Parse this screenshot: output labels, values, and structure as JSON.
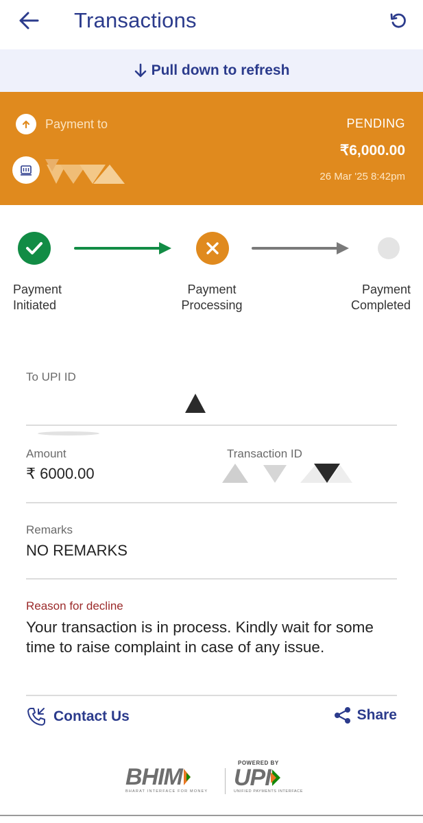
{
  "header": {
    "title": "Transactions"
  },
  "banner": {
    "text": "Pull down to refresh"
  },
  "payment": {
    "direction_label": "Payment to",
    "status": "PENDING",
    "amount": "₹6,000.00",
    "datetime": "26 Mar '25 8:42pm"
  },
  "steps": [
    {
      "label": "Payment Initiated",
      "state": "done"
    },
    {
      "label": "Payment Processing",
      "state": "failed"
    },
    {
      "label": "Payment Completed",
      "state": "pending"
    }
  ],
  "details": {
    "upi_label": "To UPI ID",
    "amount_label": "Amount",
    "amount_value": "₹ 6000.00",
    "txn_label": "Transaction ID",
    "remarks_label": "Remarks",
    "remarks_value": "NO REMARKS",
    "reason_label": "Reason for decline",
    "reason_value": "Your transaction is in process. Kindly wait for some time to raise complaint in case of any issue."
  },
  "actions": {
    "contact": "Contact Us",
    "share": "Share"
  },
  "footer": {
    "bhim": "BHIM",
    "bhim_tagline": "BHARAT INTERFACE FOR MONEY",
    "powered_by": "POWERED BY",
    "upi": "UPI",
    "upi_tagline": "UNIFIED PAYMENTS INTERFACE"
  },
  "colors": {
    "brand_navy": "#2b3b8c",
    "pending_orange": "#e08a1e",
    "success_green": "#128c45",
    "decline_red": "#9b2a2a"
  }
}
